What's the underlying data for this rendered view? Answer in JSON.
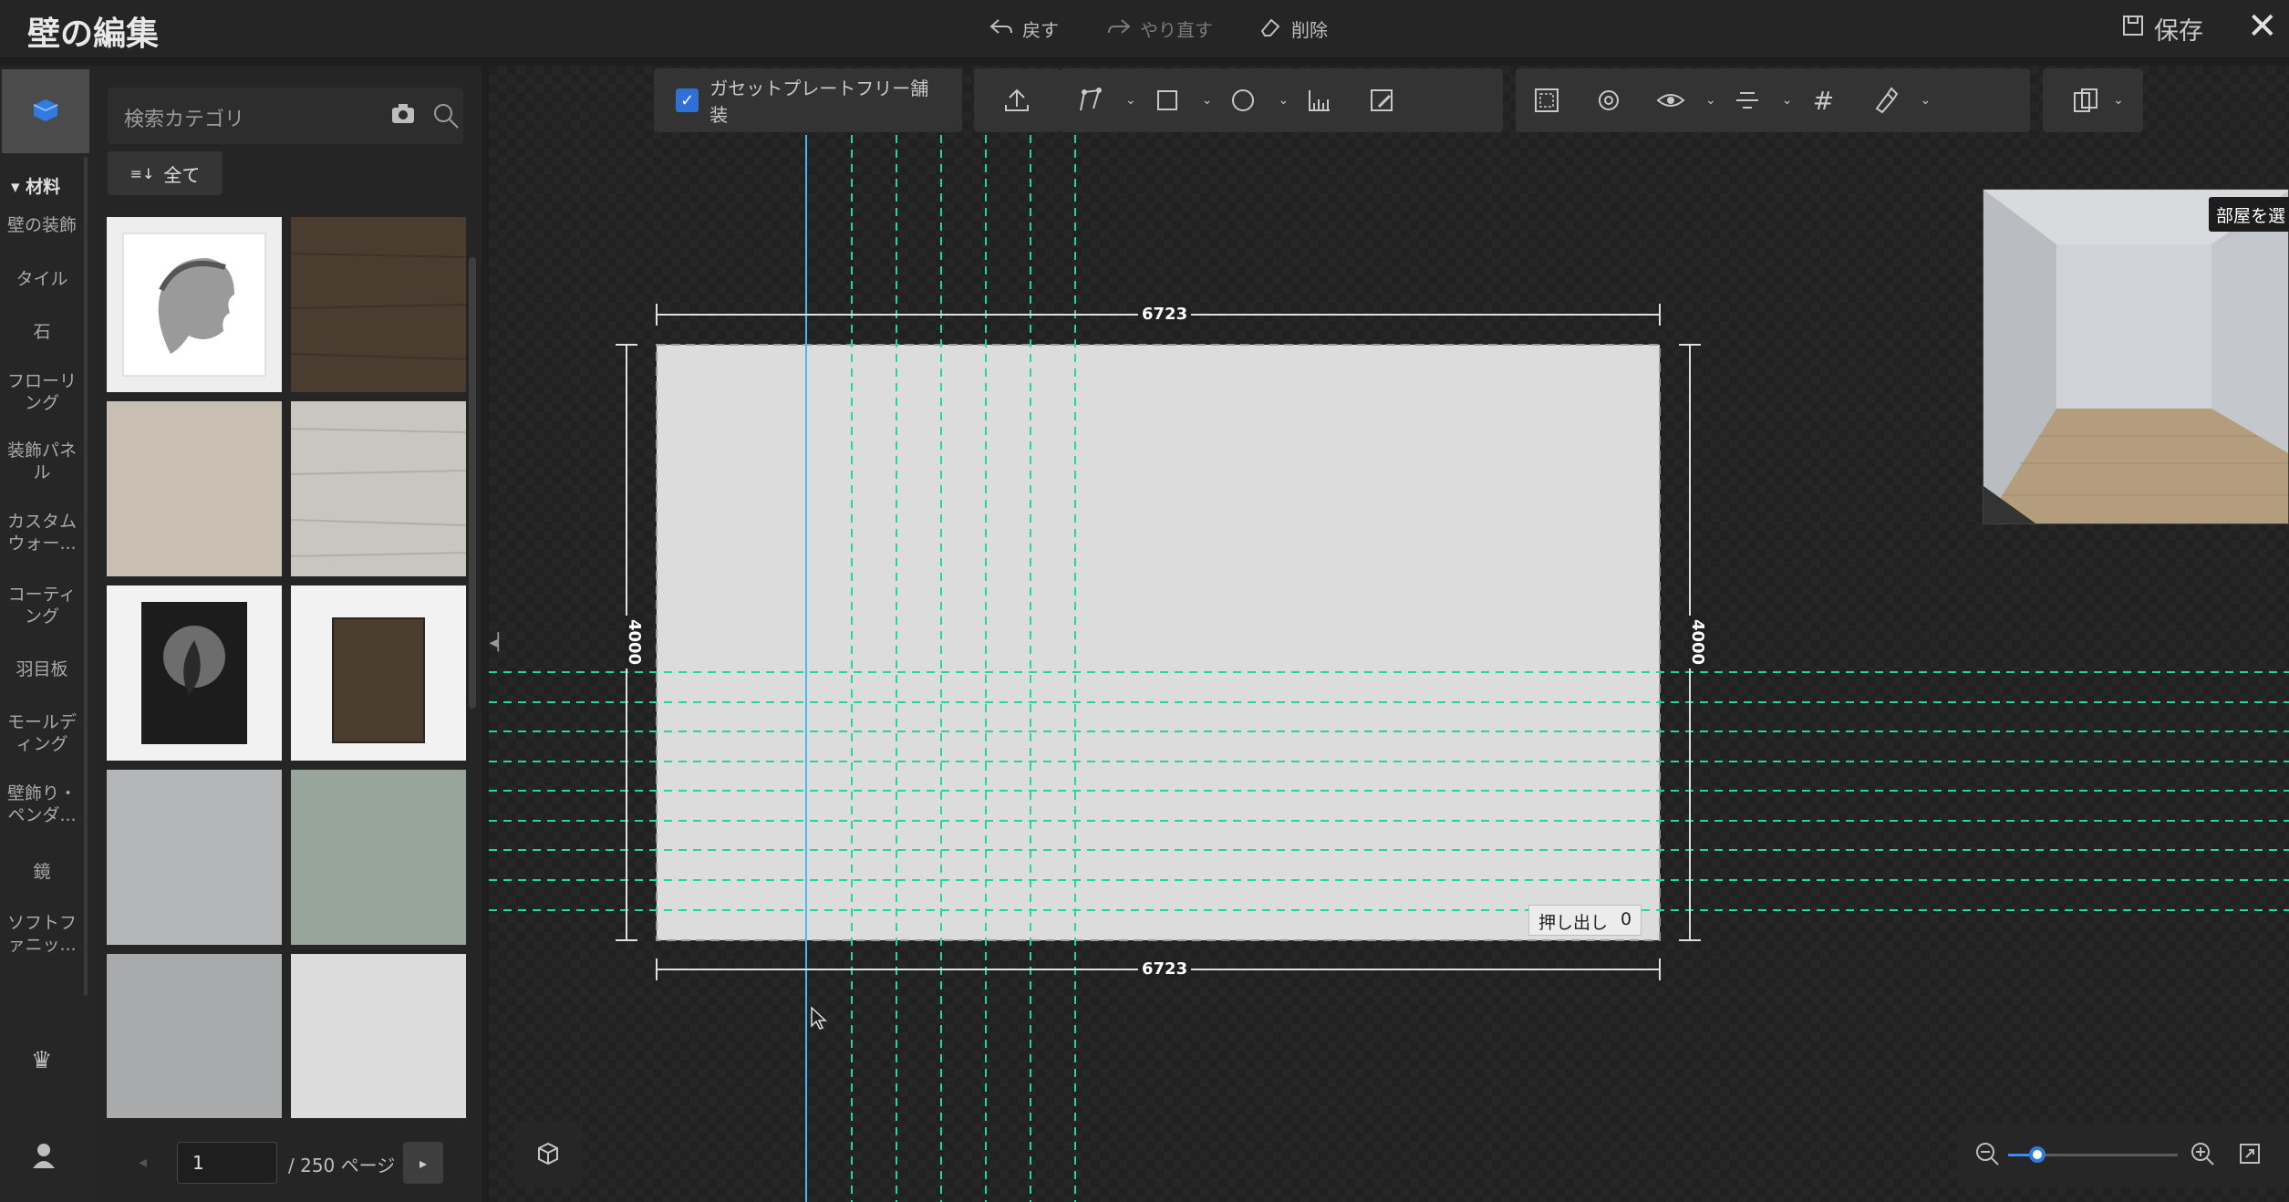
{
  "header": {
    "title": "壁の編集",
    "undo_label": "戻す",
    "redo_label": "やり直す",
    "delete_label": "削除",
    "save_label": "保存"
  },
  "sidebar": {
    "category_header": "材料",
    "categories": [
      [
        "壁の装飾"
      ],
      [
        "タイル"
      ],
      [
        "石"
      ],
      [
        "フローリ",
        "ング"
      ],
      [
        "装飾パネ",
        "ル"
      ],
      [
        "カスタム",
        "ウォー..."
      ],
      [
        "コーティ",
        "ング"
      ],
      [
        "羽目板"
      ],
      [
        "モールデ",
        "ィング"
      ],
      [
        "壁飾り・",
        "ペンダ..."
      ],
      [
        "鏡"
      ],
      [
        "ソフトフ",
        "ァニッ..."
      ]
    ]
  },
  "materials": {
    "search_placeholder": "検索カテゴリ",
    "filter_label": "全て",
    "thumbnails": [
      {
        "name": "portrait-sketch",
        "color": "#eeeeee"
      },
      {
        "name": "dark-wood",
        "color": "#4b3c30"
      },
      {
        "name": "beige-plaster",
        "color": "#c8beb2"
      },
      {
        "name": "whitewash-wood",
        "color": "#c9c6bf"
      },
      {
        "name": "framed-leaf-art",
        "color": "#f2f2f2"
      },
      {
        "name": "framed-brown-panel",
        "color": "#f2f2f2"
      },
      {
        "name": "grey-concrete",
        "color": "#b5b6b8"
      },
      {
        "name": "sage-green",
        "color": "#97a59b"
      },
      {
        "name": "mid-grey",
        "color": "#a9aaac"
      },
      {
        "name": "light-grey",
        "color": "#dcdcdc"
      }
    ],
    "pager": {
      "current": "1",
      "total_label": "/ 250 ページ"
    }
  },
  "toolbar": {
    "gusset_label": "ガセットプレートフリー舗装",
    "gusset_checked": true
  },
  "canvas": {
    "width_dim": "6723",
    "height_dim": "4000",
    "extrude_label": "押し出し",
    "extrude_value": "0",
    "room_select_label": "部屋を選"
  },
  "zoom": {
    "level": 0.17
  }
}
